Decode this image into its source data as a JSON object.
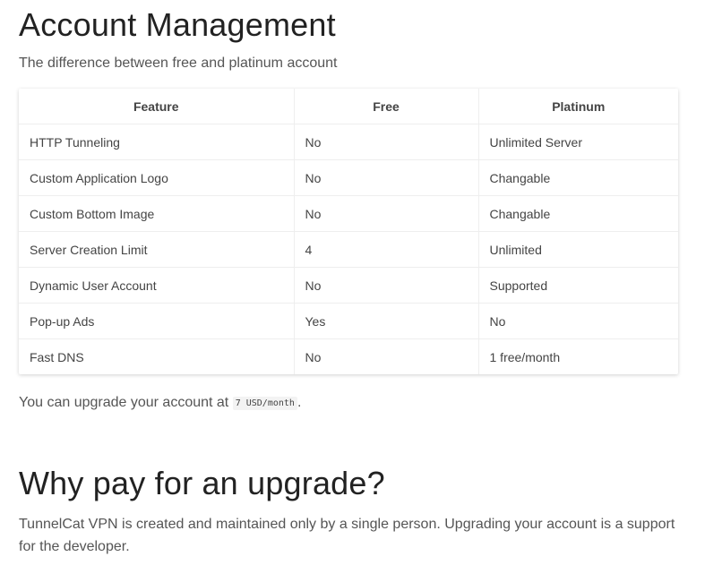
{
  "page": {
    "title": "Account Management",
    "subtitle": "The difference between free and platinum account"
  },
  "table": {
    "headers": [
      "Feature",
      "Free",
      "Platinum"
    ],
    "rows": [
      [
        "HTTP Tunneling",
        "No",
        "Unlimited Server"
      ],
      [
        "Custom Application Logo",
        "No",
        "Changable"
      ],
      [
        "Custom Bottom Image",
        "No",
        "Changable"
      ],
      [
        "Server Creation Limit",
        "4",
        "Unlimited"
      ],
      [
        "Dynamic User Account",
        "No",
        "Supported"
      ],
      [
        "Pop-up Ads",
        "Yes",
        "No"
      ],
      [
        "Fast DNS",
        "No",
        "1 free/month"
      ]
    ]
  },
  "upgrade": {
    "prefix": "You can upgrade your account at",
    "price": "7 USD/month",
    "suffix": "."
  },
  "why": {
    "title": "Why pay for an upgrade?",
    "text": "TunnelCat VPN is created and maintained only by a single person. Upgrading your account is a support for the developer."
  }
}
